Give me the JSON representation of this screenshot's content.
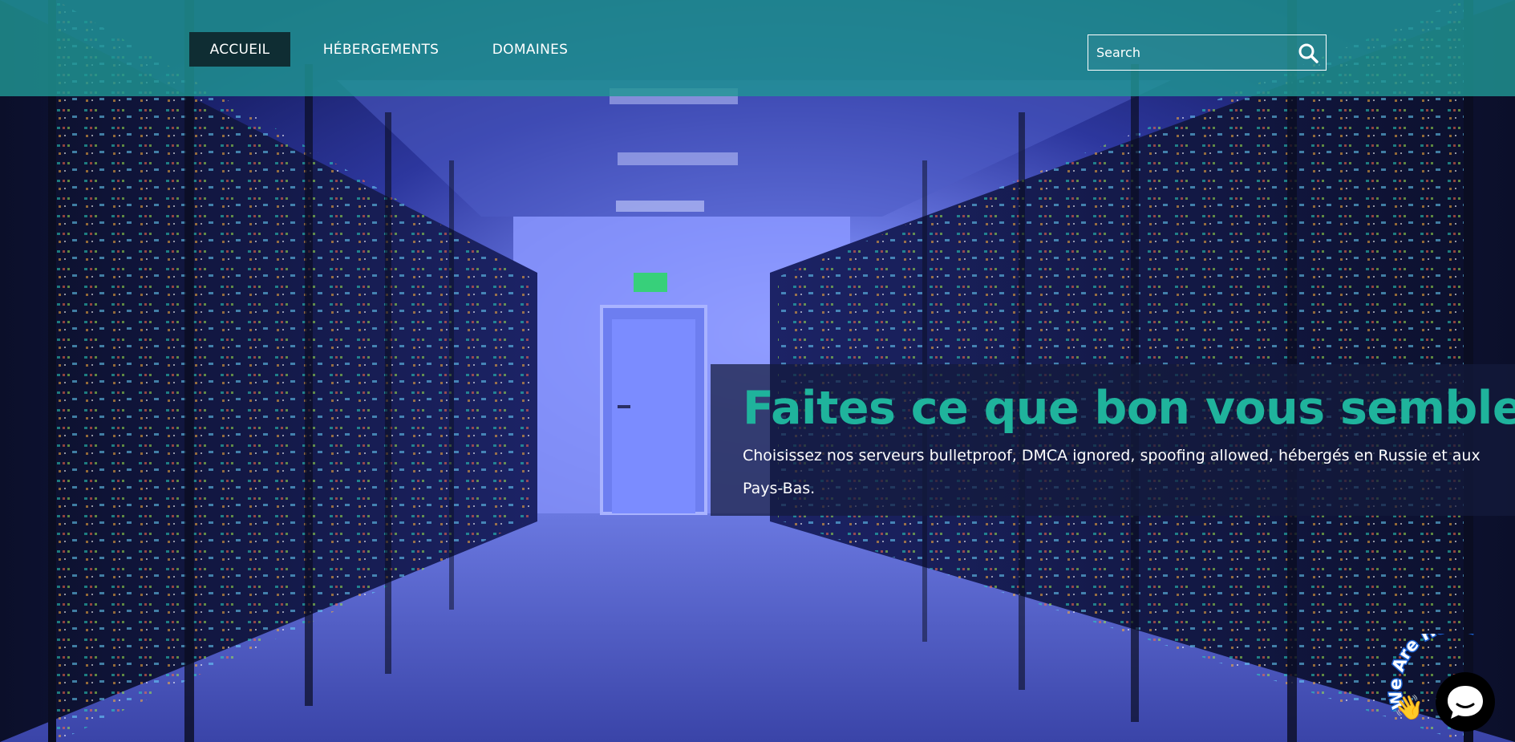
{
  "colors": {
    "topbar": "#209694",
    "nav_active": "#0f2d33",
    "accent": "#1fb39c",
    "tagline_panel": "#141a3c",
    "hero_base": "#1c2580"
  },
  "nav": {
    "items": [
      {
        "label": "ACCUEIL",
        "active": true
      },
      {
        "label": "HÉBERGEMENTS",
        "active": false
      },
      {
        "label": "DOMAINES",
        "active": false
      }
    ]
  },
  "search": {
    "placeholder": "Search",
    "value": "",
    "icon": "search-icon"
  },
  "hero": {
    "background": "server-room-image",
    "title": "Faites ce que bon vous semble",
    "subtitle": "Choisissez nos serveurs bulletproof, DMCA ignored, spoofing allowed, hébergés en Russie et aux Pays-Bas."
  },
  "chat": {
    "arc_text": "We Are Here!",
    "wave_emoji": "👋",
    "icon": "chat-bubble-icon"
  }
}
